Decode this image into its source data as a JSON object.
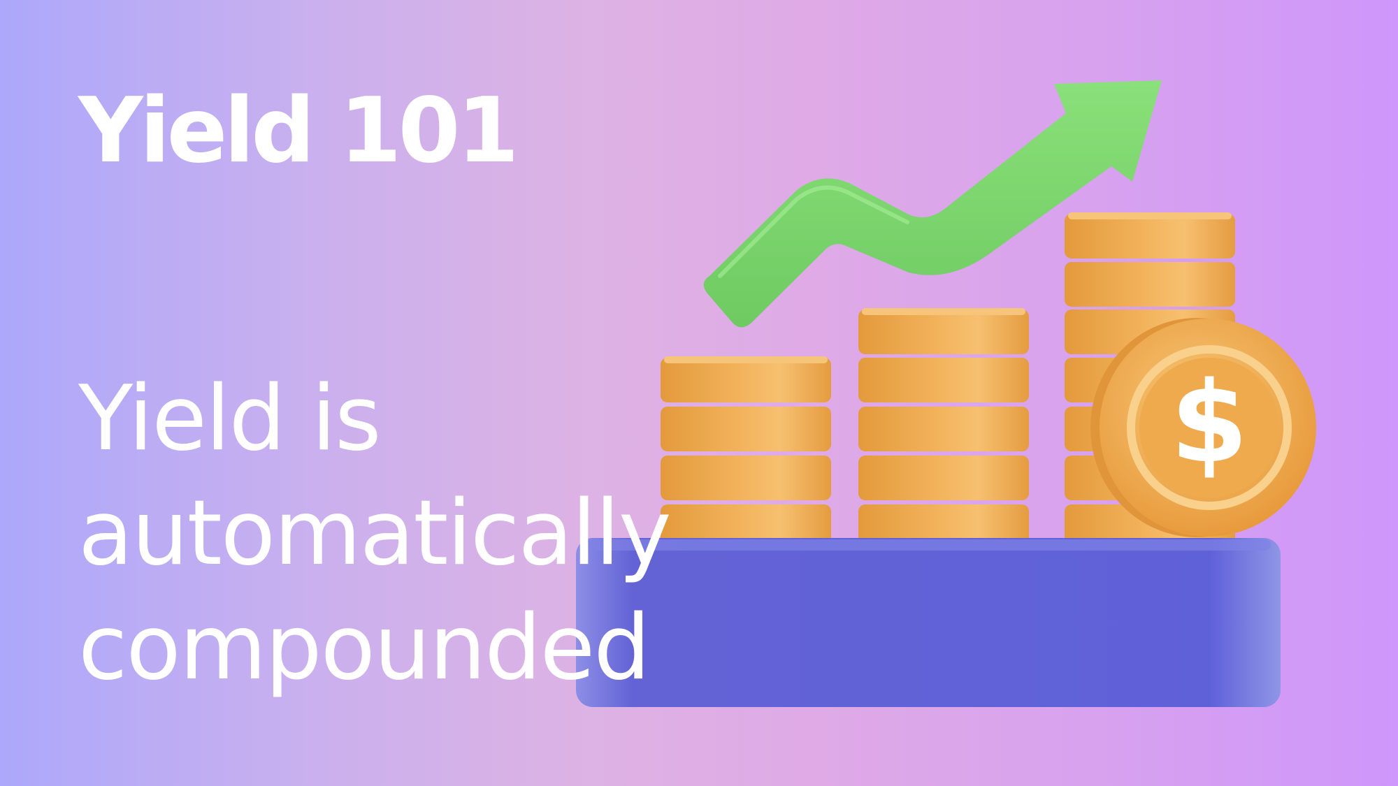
{
  "slide": {
    "title": "Yield 101",
    "body_lines": [
      "Yield is",
      "automatically",
      "compounded"
    ]
  },
  "illustration": {
    "icons": [
      "growth-arrow-icon",
      "coin-stack-icon",
      "dollar-coin-icon",
      "platform-base"
    ],
    "colors": {
      "arrow": "#7ed66f",
      "coin": "#eba54a",
      "coin_light": "#f6c16b",
      "platform": "#6160d8",
      "text": "#ffffff"
    }
  }
}
